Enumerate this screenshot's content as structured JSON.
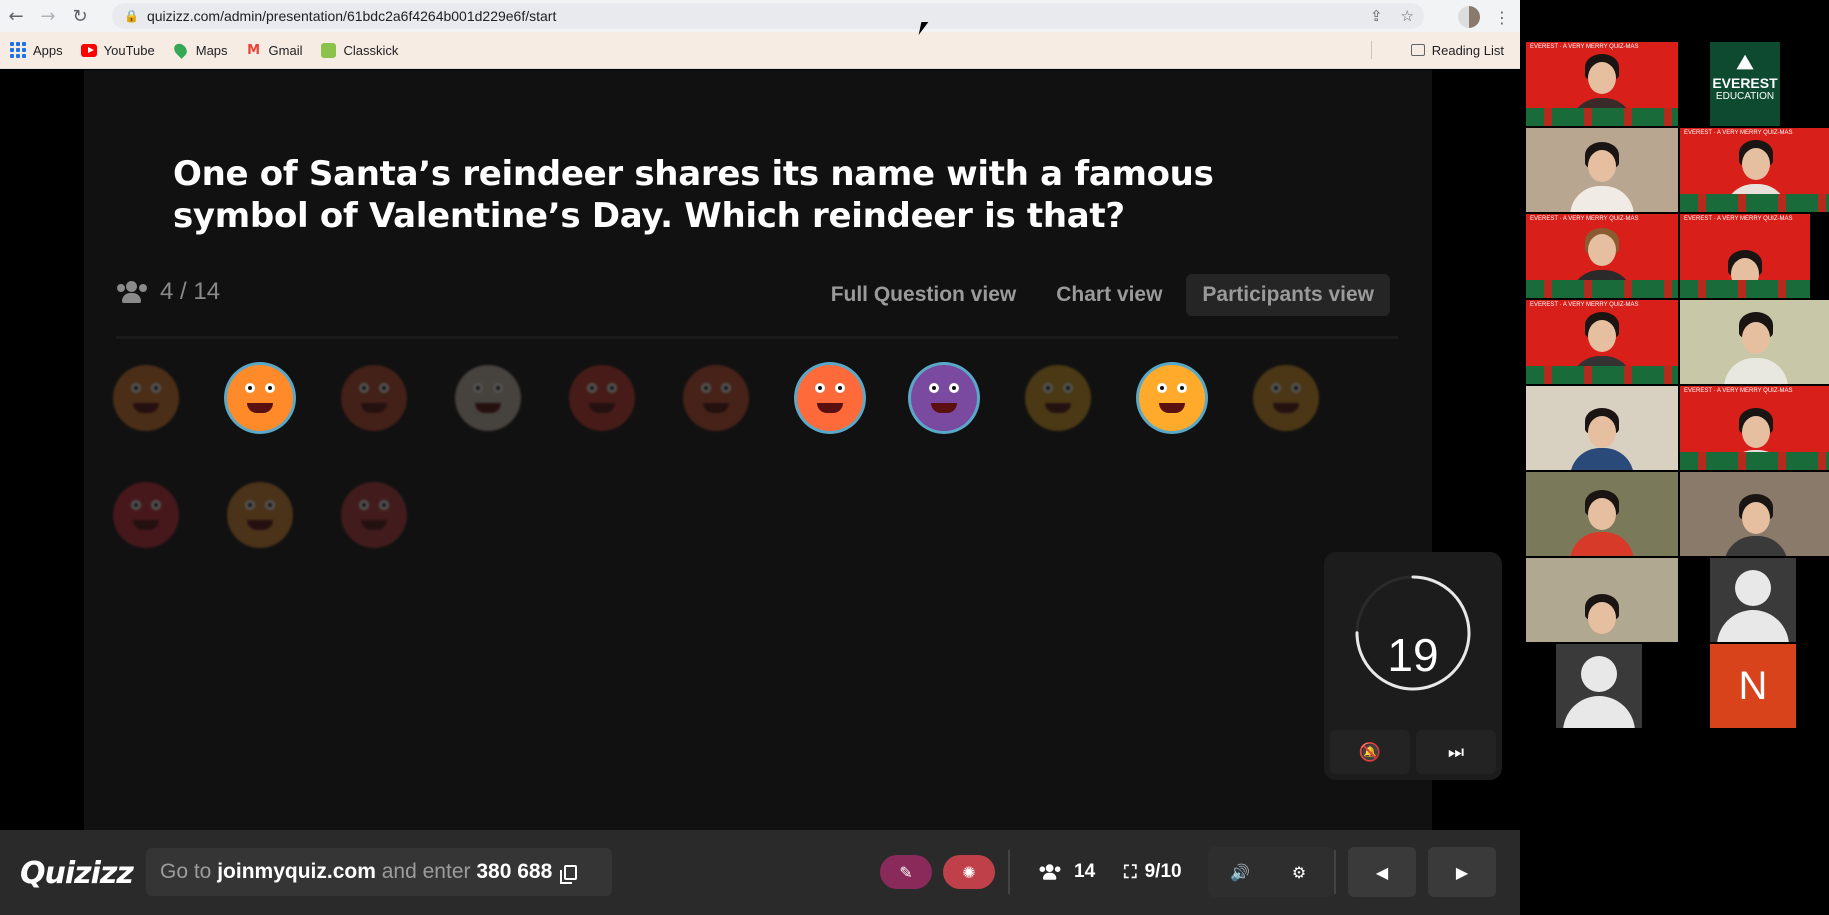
{
  "browser": {
    "url": "quizizz.com/admin/presentation/61bdc2a6f4264b001d229e6f/start",
    "bookmarks": [
      {
        "label": "Apps",
        "icon": "apps-grid-icon"
      },
      {
        "label": "YouTube",
        "icon": "youtube-icon"
      },
      {
        "label": "Maps",
        "icon": "maps-icon"
      },
      {
        "label": "Gmail",
        "icon": "gmail-icon"
      },
      {
        "label": "Classkick",
        "icon": "classkick-icon"
      }
    ],
    "reading_list": "Reading List"
  },
  "quiz": {
    "question": "One of Santa’s reindeer shares its name with a famous symbol of Valentine’s Day. Which reindeer is that?",
    "answered_count": "4 / 14",
    "tabs": [
      "Full Question view",
      "Chart view",
      "Participants view"
    ],
    "active_tab": "Participants view",
    "participants": [
      {
        "answered": false,
        "color": "#e07a2a"
      },
      {
        "answered": true,
        "color": "#ff8a2a"
      },
      {
        "answered": false,
        "color": "#c44a2a"
      },
      {
        "answered": false,
        "color": "#d0c0b0"
      },
      {
        "answered": false,
        "color": "#d43a2a"
      },
      {
        "answered": false,
        "color": "#d05030"
      },
      {
        "answered": true,
        "color": "#ff6a3a"
      },
      {
        "answered": true,
        "color": "#7a4aa0"
      },
      {
        "answered": false,
        "color": "#e0a020"
      },
      {
        "answered": true,
        "color": "#ffaa2a"
      },
      {
        "answered": false,
        "color": "#e09a20"
      },
      {
        "answered": false,
        "color": "#d02a3a"
      },
      {
        "answered": false,
        "color": "#e08a30"
      },
      {
        "answered": false,
        "color": "#c03a3a"
      }
    ],
    "timer": "19",
    "timer_fraction": 0.75
  },
  "bottom_bar": {
    "logo": "Quizizz",
    "join_prefix": "Go to",
    "join_site": "joinmyquiz.com",
    "join_middle": "and enter",
    "join_code": "380 688",
    "participants": "14",
    "slide": "9/10"
  },
  "gallery": {
    "everest_line1": "EVEREST",
    "everest_line2": "EDUCATION",
    "initial": "N",
    "banner_text": "A VERY MERRY QUIZ-MAS",
    "banner_brand": "EVEREST"
  },
  "colors": {
    "timer_ring": "#e8e8e8",
    "tile_red": "#d81f1a",
    "accent_pill1": "#8a2a5a",
    "accent_pill2": "#c0404a"
  }
}
